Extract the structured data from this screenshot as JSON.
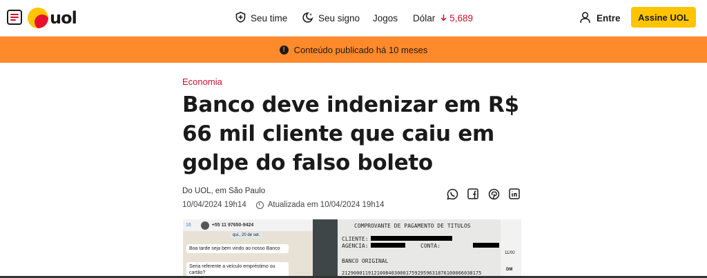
{
  "header": {
    "logo_text": "uol",
    "nav": [
      {
        "label": "Seu time",
        "icon": "shield-icon"
      },
      {
        "label": "Seu signo",
        "icon": "moon-stars-icon"
      },
      {
        "label": "Jogos"
      },
      {
        "label": "Dólar",
        "icon": "arrow-down-icon",
        "value": "5,689"
      }
    ],
    "login_label": "Entre",
    "subscribe_label": "Assine UOL"
  },
  "notice": {
    "text": "Conteúdo publicado há 10 meses",
    "icon_glyph": "!"
  },
  "article": {
    "category": "Economia",
    "title": "Banco deve indenizar em R$ 66 mil cliente que caiu em golpe do falso boleto",
    "byline": "Do UOL, em São Paulo",
    "published": "10/04/2024 19h14",
    "updated": "Atualizada em 10/04/2024 19h14",
    "share_icons": [
      "whatsapp-icon",
      "facebook-icon",
      "pinterest-icon",
      "linkedin-icon"
    ]
  },
  "photo": {
    "chat_phone": "+55 11 97650-9424",
    "chat_back": "16",
    "chat_date": "qui., 20 de set.",
    "chat_msg1": "Boa tarde seja bem vindo ao nosso Banco",
    "chat_msg2": "Seria referente a veículo empréstimo ou cartão?",
    "doc_title": "COMPROVANTE DE PAGAMENTO DE TITULOS",
    "doc_cliente": "CLIENTE:",
    "doc_agencia": "AGENCIA:",
    "doc_conta": "CONTA:",
    "doc_banco": "BANCO ORIGINAL",
    "doc_code": "212900011912100840300017592959631876100066038175",
    "doc_right_1": "11/00",
    "doc_right_2": "DM"
  },
  "colors": {
    "brand_red": "#c8102e",
    "brand_yellow": "#ffc400",
    "notice_orange": "#ff8a2b"
  }
}
